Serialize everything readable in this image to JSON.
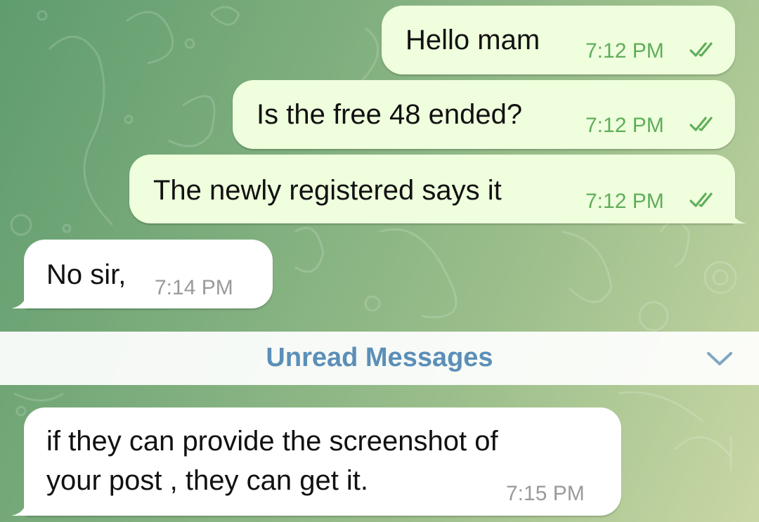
{
  "chat": {
    "messages": [
      {
        "direction": "outgoing",
        "text": "Hello mam",
        "time": "7:12 PM",
        "status": "read"
      },
      {
        "direction": "outgoing",
        "text": "Is the free 48 ended?",
        "time": "7:12 PM",
        "status": "read"
      },
      {
        "direction": "outgoing",
        "text": "The newly registered says it",
        "time": "7:12 PM",
        "status": "read"
      },
      {
        "direction": "incoming",
        "text": "No sir,",
        "time": "7:14 PM"
      },
      {
        "direction": "incoming",
        "text_lines": [
          "if they can provide the screenshot of",
          "your post , they can get it."
        ],
        "time": "7:15 PM"
      }
    ],
    "unread_divider": {
      "label": "Unread Messages",
      "icon": "chevron-down-icon"
    }
  },
  "colors": {
    "outgoing_bubble": "#effedd",
    "incoming_bubble": "#ffffff",
    "outgoing_time": "#5fae5a",
    "read_ticks": "#5fae5a",
    "unread_label": "#5b8fb8",
    "background": "#7fae7e"
  }
}
